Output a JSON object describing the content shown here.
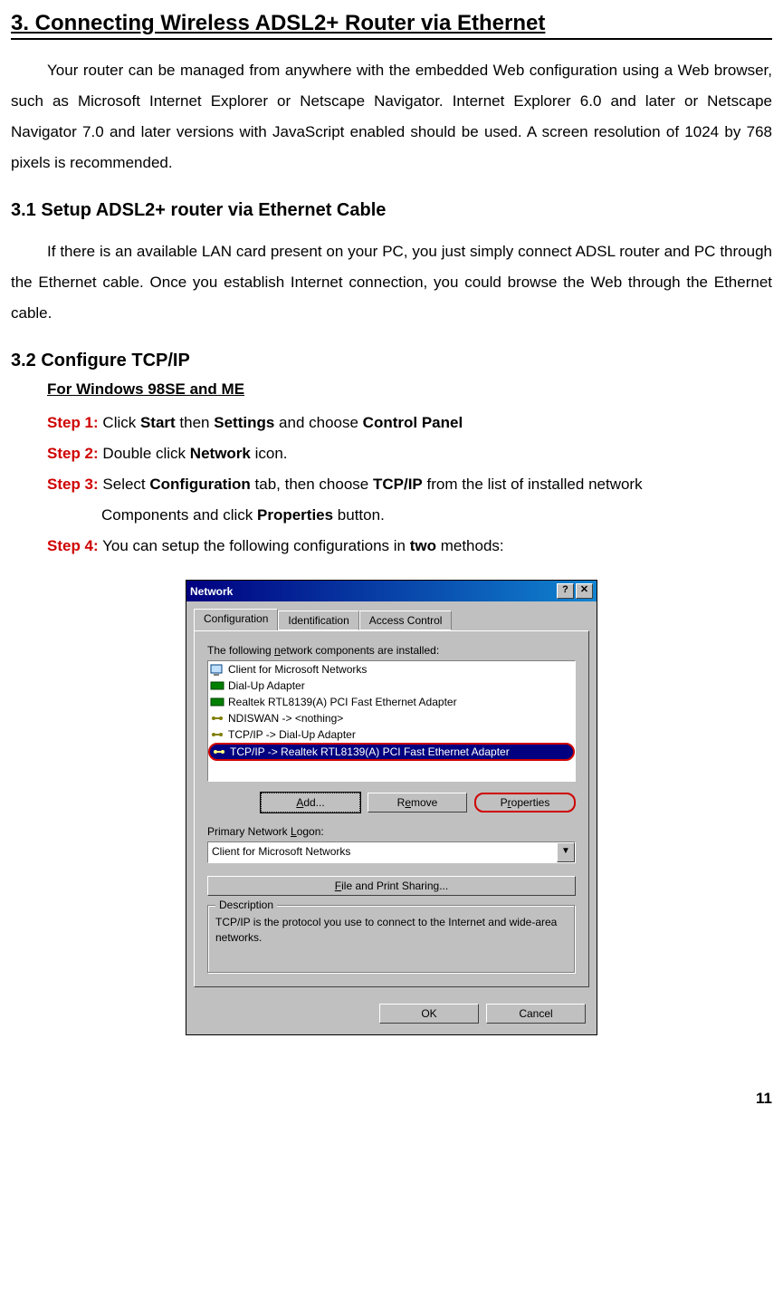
{
  "sections": {
    "main_title": "3. Connecting Wireless ADSL2+ Router via Ethernet",
    "intro_para": "Your router can be managed from anywhere with the embedded Web configuration using a Web browser, such as Microsoft Internet Explorer or Netscape Navigator. Internet Explorer 6.0 and later or Netscape Navigator 7.0 and later versions with JavaScript enabled should be used. A screen resolution of 1024 by 768 pixels is recommended.",
    "sub1_title": "3.1 Setup ADSL2+ router via Ethernet Cable",
    "sub1_para": "If there is an available LAN card present on your PC, you just simply connect ADSL router and PC through the Ethernet cable. Once you establish Internet connection, you could browse the Web through the Ethernet cable.",
    "sub2_title": "3.2 Configure TCP/IP",
    "os_title": "For Windows 98SE and ME",
    "steps": {
      "s1": {
        "label": "Step 1:",
        "pre": " Click ",
        "b1": "Start",
        "mid1": " then ",
        "b2": "Settings",
        "mid2": " and choose ",
        "b3": "Control Panel"
      },
      "s2": {
        "label": "Step 2:",
        "pre": " Double click ",
        "b1": "Network",
        "post": " icon."
      },
      "s3": {
        "label": "Step 3:",
        "pre": " Select ",
        "b1": "Configuration",
        "mid1": " tab, then choose ",
        "b2": "TCP/IP",
        "mid2": " from the list of installed network",
        "cont_pre": "Components and click ",
        "b3": "Properties",
        "cont_post": " button."
      },
      "s4": {
        "label": "Step 4:",
        "pre": " You can setup the following configurations in ",
        "b1": "two",
        "post": " methods:"
      }
    }
  },
  "dialog": {
    "title": "Network",
    "tabs": [
      "Configuration",
      "Identification",
      "Access Control"
    ],
    "list_label_pre": "The following ",
    "list_label_ul": "n",
    "list_label_post": "etwork components are installed:",
    "list_items": [
      "Client for Microsoft Networks",
      "Dial-Up Adapter",
      "Realtek RTL8139(A) PCI Fast Ethernet Adapter",
      "NDISWAN -> <nothing>",
      "TCP/IP -> Dial-Up Adapter",
      "TCP/IP -> Realtek RTL8139(A) PCI Fast Ethernet Adapter"
    ],
    "buttons": {
      "add": "Add...",
      "remove": "Remove",
      "properties": "Properties"
    },
    "logon_label_pre": "Primary Network ",
    "logon_label_ul": "L",
    "logon_label_post": "ogon:",
    "logon_value": "Client for Microsoft Networks",
    "file_share_pre": "",
    "file_share_ul": "F",
    "file_share_post": "ile and Print Sharing...",
    "group_legend": "Description",
    "desc_text": "TCP/IP is the protocol you use to connect to the Internet and wide-area networks.",
    "ok": "OK",
    "cancel": "Cancel"
  },
  "page_number": "11"
}
